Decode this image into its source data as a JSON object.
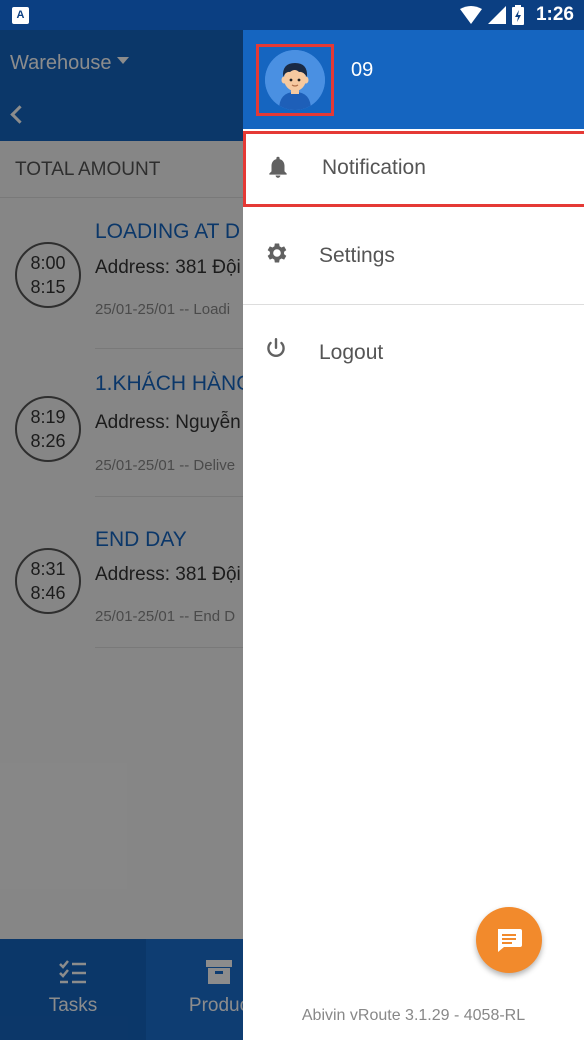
{
  "status_bar": {
    "time": "1:26"
  },
  "background": {
    "warehouse_label": "Warehouse",
    "total_amount_label": "TOTAL AMOUNT",
    "tasks": [
      {
        "start": "8:00",
        "end": "8:15",
        "title": "LOADING AT D",
        "address": "Address: 381 Đội",
        "meta": "25/01-25/01 -- Loadi"
      },
      {
        "start": "8:19",
        "end": "8:26",
        "title": "1.KHÁCH HÀNG",
        "address": "Address: Nguyễn",
        "meta": "25/01-25/01 -- Delive"
      },
      {
        "start": "8:31",
        "end": "8:46",
        "title": "END DAY",
        "address": "Address: 381 Đội",
        "meta": "25/01-25/01 -- End D"
      }
    ],
    "bottom_nav": [
      {
        "label": "Tasks",
        "icon": "checklist-icon"
      },
      {
        "label": "Produc",
        "icon": "archive-box-icon"
      }
    ]
  },
  "drawer": {
    "username": "09",
    "menu": [
      {
        "label": "Notification",
        "icon": "bell-icon"
      },
      {
        "label": "Settings",
        "icon": "gear-icon"
      },
      {
        "label": "Logout",
        "icon": "power-icon"
      }
    ],
    "fab_icon": "chat-icon",
    "version": "Abivin vRoute 3.1.29 - 4058-RL"
  },
  "colors": {
    "primary": "#1565c0",
    "accent": "#f28a2c",
    "highlight_border": "#e53935"
  }
}
